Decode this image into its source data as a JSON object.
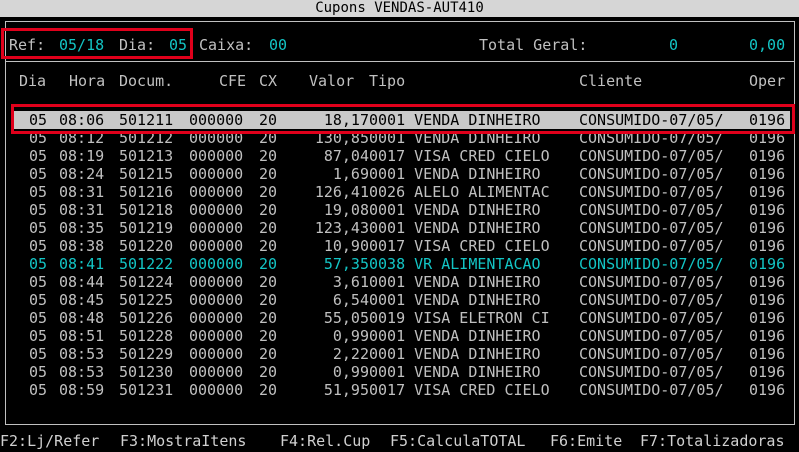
{
  "window_title": "Cupons VENDAS-AUT410",
  "summary": {
    "ref_label": "Ref:",
    "ref_value": "05/18",
    "dia_label": "Dia:",
    "dia_value": "05",
    "caixa_label": "Caixa:",
    "caixa_value": "00",
    "total_label": "Total Geral:",
    "total_count": "0",
    "total_value": "0,00"
  },
  "columns": [
    "Dia",
    "Hora",
    "Docum.",
    "CFE",
    "CX",
    "Valor",
    "Tipo",
    "Cliente",
    "Oper"
  ],
  "rows": [
    {
      "dia": "05",
      "hora": "08:06",
      "doc": "501211",
      "cfe": "000000",
      "cx": "20",
      "valor": "18,17",
      "tipo": "0001 VENDA DINHEIRO",
      "cliente": "CONSUMIDO-07/05/",
      "oper": "0196",
      "selected": true
    },
    {
      "dia": "05",
      "hora": "08:12",
      "doc": "501212",
      "cfe": "000000",
      "cx": "20",
      "valor": "130,85",
      "tipo": "0001 VENDA DINHEIRO",
      "cliente": "CONSUMIDO-07/05/",
      "oper": "0196"
    },
    {
      "dia": "05",
      "hora": "08:19",
      "doc": "501213",
      "cfe": "000000",
      "cx": "20",
      "valor": "87,04",
      "tipo": "0017 VISA CRED CIELO",
      "cliente": "CONSUMIDO-07/05/",
      "oper": "0196"
    },
    {
      "dia": "05",
      "hora": "08:24",
      "doc": "501215",
      "cfe": "000000",
      "cx": "20",
      "valor": "1,69",
      "tipo": "0001 VENDA DINHEIRO",
      "cliente": "CONSUMIDO-07/05/",
      "oper": "0196"
    },
    {
      "dia": "05",
      "hora": "08:31",
      "doc": "501216",
      "cfe": "000000",
      "cx": "20",
      "valor": "126,41",
      "tipo": "0026 ALELO ALIMENTAC",
      "cliente": "CONSUMIDO-07/05/",
      "oper": "0196"
    },
    {
      "dia": "05",
      "hora": "08:31",
      "doc": "501218",
      "cfe": "000000",
      "cx": "20",
      "valor": "19,08",
      "tipo": "0001 VENDA DINHEIRO",
      "cliente": "CONSUMIDO-07/05/",
      "oper": "0196"
    },
    {
      "dia": "05",
      "hora": "08:35",
      "doc": "501219",
      "cfe": "000000",
      "cx": "20",
      "valor": "123,43",
      "tipo": "0001 VENDA DINHEIRO",
      "cliente": "CONSUMIDO-07/05/",
      "oper": "0196"
    },
    {
      "dia": "05",
      "hora": "08:38",
      "doc": "501220",
      "cfe": "000000",
      "cx": "20",
      "valor": "10,90",
      "tipo": "0017 VISA CRED CIELO",
      "cliente": "CONSUMIDO-07/05/",
      "oper": "0196"
    },
    {
      "dia": "05",
      "hora": "08:41",
      "doc": "501222",
      "cfe": "000000",
      "cx": "20",
      "valor": "57,35",
      "tipo": "0038 VR ALIMENTACAO",
      "cliente": "CONSUMIDO-07/05/",
      "oper": "0196",
      "highlight": true
    },
    {
      "dia": "05",
      "hora": "08:44",
      "doc": "501224",
      "cfe": "000000",
      "cx": "20",
      "valor": "3,61",
      "tipo": "0001 VENDA DINHEIRO",
      "cliente": "CONSUMIDO-07/05/",
      "oper": "0196"
    },
    {
      "dia": "05",
      "hora": "08:45",
      "doc": "501225",
      "cfe": "000000",
      "cx": "20",
      "valor": "6,54",
      "tipo": "0001 VENDA DINHEIRO",
      "cliente": "CONSUMIDO-07/05/",
      "oper": "0196"
    },
    {
      "dia": "05",
      "hora": "08:48",
      "doc": "501226",
      "cfe": "000000",
      "cx": "20",
      "valor": "55,05",
      "tipo": "0019 VISA ELETRON CI",
      "cliente": "CONSUMIDO-07/05/",
      "oper": "0196"
    },
    {
      "dia": "05",
      "hora": "08:51",
      "doc": "501228",
      "cfe": "000000",
      "cx": "20",
      "valor": "0,99",
      "tipo": "0001 VENDA DINHEIRO",
      "cliente": "CONSUMIDO-07/05/",
      "oper": "0196"
    },
    {
      "dia": "05",
      "hora": "08:53",
      "doc": "501229",
      "cfe": "000000",
      "cx": "20",
      "valor": "2,22",
      "tipo": "0001 VENDA DINHEIRO",
      "cliente": "CONSUMIDO-07/05/",
      "oper": "0196"
    },
    {
      "dia": "05",
      "hora": "08:53",
      "doc": "501230",
      "cfe": "000000",
      "cx": "20",
      "valor": "0,99",
      "tipo": "0001 VENDA DINHEIRO",
      "cliente": "CONSUMIDO-07/05/",
      "oper": "0196"
    },
    {
      "dia": "05",
      "hora": "08:59",
      "doc": "501231",
      "cfe": "000000",
      "cx": "20",
      "valor": "51,95",
      "tipo": "0017 VISA CRED CIELO",
      "cliente": "CONSUMIDO-07/05/",
      "oper": "0196"
    }
  ],
  "function_keys": [
    "F2:Lj/Refer",
    "F3:MostraItens",
    "F4:Rel.Cup",
    "F5:CalculaTOTAL",
    "F6:Emite",
    "F7:Totalizadoras"
  ],
  "colors": {
    "background": "#000000",
    "text": "#c0c0c0",
    "accent": "#13c5c5",
    "selection": "#c9c9c9",
    "annotation": "#e0001b"
  }
}
